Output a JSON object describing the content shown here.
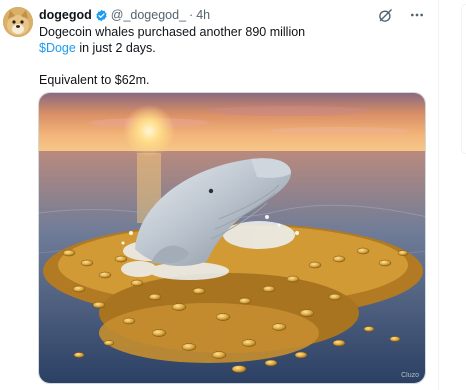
{
  "tweet": {
    "display_name": "dogegod",
    "handle": "@_dogegod_",
    "separator": "·",
    "time": "4h",
    "text_line1": "Dogecoin whales purchased another 890 million",
    "cashtag": "$Doge",
    "text_line2_rest": " in just 2 days.",
    "text_line3": "Equivalent to $62m.",
    "image_watermark": "Cluzo"
  },
  "icons": {
    "verified": "verified-badge-icon",
    "grok": "grok-icon",
    "more": "more-icon"
  },
  "colors": {
    "accent": "#1d9bf0",
    "secondary_text": "#536471"
  }
}
